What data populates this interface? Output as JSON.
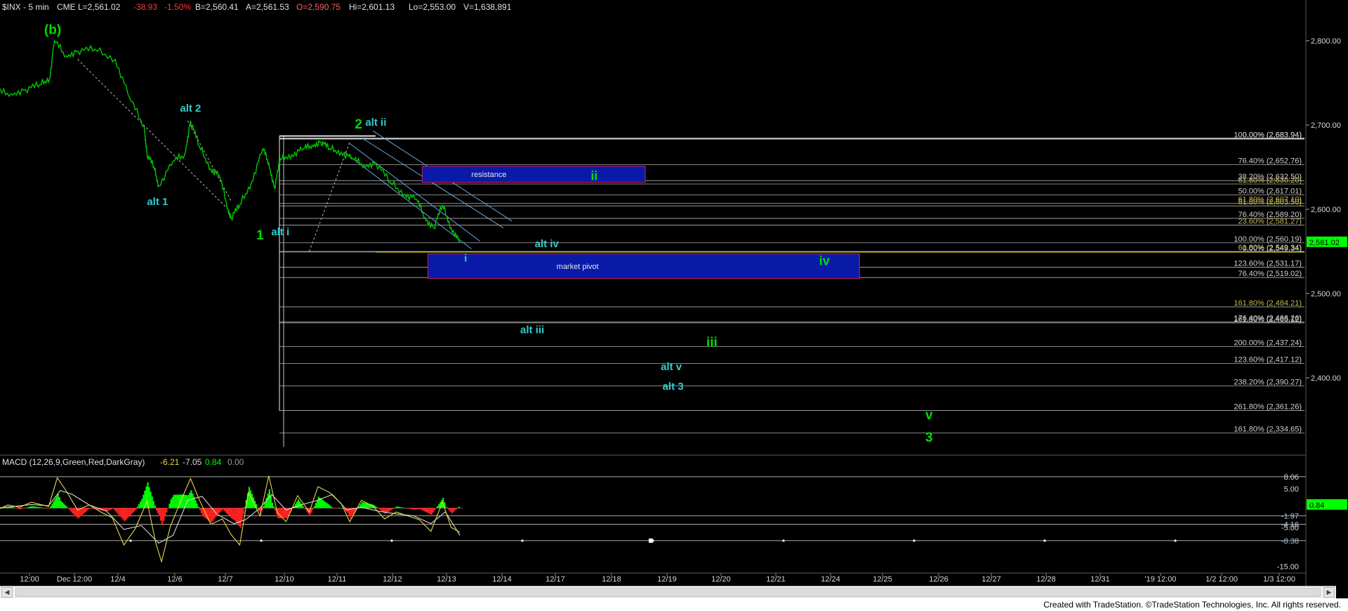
{
  "header": {
    "symbol": "$INX - 5 min",
    "exchange": "CME",
    "last": "L=2,561.02",
    "change": "-38.93",
    "pct": "-1.50%",
    "bid": "B=2,560.41",
    "ask": "A=2,561.53",
    "open": "O=2,590.75",
    "high": "Hi=2,601.13",
    "low": "Lo=2,553.00",
    "volume": "V=1,638,891"
  },
  "colors": {
    "price": "#00c800",
    "wave_green": "#00dd00",
    "wave_cyan": "#33cccc",
    "pos": "#00ff00",
    "neg": "#ff2222",
    "fib_line": "#b0b0b0",
    "box_fill": "#0a1aa8",
    "box_border": "#cc2266",
    "last_tag": "#00ff00"
  },
  "price_axis": {
    "labels": [
      "2,800.00",
      "2,700.00",
      "2,600.00",
      "2,500.00",
      "2,400.00"
    ],
    "last_price_tag": "2,561.02"
  },
  "time_axis": {
    "labels": [
      "12:00",
      "Dec 12:00",
      "12/4",
      "12/6",
      "12/7",
      "12/10",
      "12/11",
      "12/12",
      "12/13",
      "12/14",
      "12/17",
      "12/18",
      "12/19",
      "12/20",
      "12/21",
      "12/24",
      "12/25",
      "12/26",
      "12/27",
      "12/28",
      "12/31",
      "'19 12:00",
      "1/2 12:00",
      "1/3 12:00"
    ]
  },
  "chart_data": [
    {
      "type": "line",
      "title": "$INX - 5 min",
      "x_unit": "trading-session index (0 = 11/30, 1 = 12/3 … 11 = 12/17)",
      "ylim": [
        2315,
        2830
      ],
      "grid": false,
      "price_path": [
        [
          0.0,
          2740
        ],
        [
          0.25,
          2737
        ],
        [
          0.5,
          2742
        ],
        [
          0.75,
          2748
        ],
        [
          0.92,
          2756
        ],
        [
          1.0,
          2800
        ],
        [
          1.2,
          2782
        ],
        [
          1.4,
          2788
        ],
        [
          1.7,
          2790
        ],
        [
          2.05,
          2778
        ],
        [
          2.3,
          2732
        ],
        [
          2.55,
          2698
        ],
        [
          2.6,
          2665
        ],
        [
          2.72,
          2650
        ],
        [
          2.8,
          2628
        ],
        [
          3.05,
          2657
        ],
        [
          3.25,
          2665
        ],
        [
          3.35,
          2705
        ],
        [
          3.5,
          2675
        ],
        [
          3.7,
          2648
        ],
        [
          3.85,
          2640
        ],
        [
          4.0,
          2600
        ],
        [
          4.05,
          2590
        ],
        [
          4.2,
          2605
        ],
        [
          4.4,
          2632
        ],
        [
          4.6,
          2672
        ],
        [
          4.7,
          2655
        ],
        [
          4.8,
          2625
        ],
        [
          4.9,
          2660
        ],
        [
          5.1,
          2665
        ],
        [
          5.3,
          2672
        ],
        [
          5.45,
          2676
        ],
        [
          5.6,
          2680
        ],
        [
          5.75,
          2672
        ],
        [
          5.95,
          2668
        ],
        [
          6.15,
          2660
        ],
        [
          6.35,
          2652
        ],
        [
          6.55,
          2655
        ],
        [
          6.8,
          2632
        ],
        [
          7.05,
          2618
        ],
        [
          7.25,
          2612
        ],
        [
          7.4,
          2590
        ],
        [
          7.55,
          2578
        ],
        [
          7.7,
          2605
        ],
        [
          7.85,
          2578
        ],
        [
          8.0,
          2561
        ]
      ],
      "fib_levels": [
        {
          "pct": "100.00%",
          "value": "2,683.94",
          "y": 2683.9
        },
        {
          "pct": "0.00%",
          "value": "2,683.94",
          "y": 2683.9
        },
        {
          "pct": "76.40%",
          "value": "2,652.76",
          "y": 2652.8
        },
        {
          "pct": "38.20%",
          "value": "2,632.50",
          "y": 2634.0
        },
        {
          "pct": "61.80%",
          "value": "2,630.20",
          "y": 2630.0
        },
        {
          "pct": "50.00%",
          "value": "2,617.01",
          "y": 2617.0
        },
        {
          "pct": "61.80%",
          "value": "2,607.10",
          "y": 2607.1
        },
        {
          "pct": "61.80%",
          "value": "2,603.50",
          "y": 2604.0
        },
        {
          "pct": "76.40%",
          "value": "2,589.20",
          "y": 2589.2
        },
        {
          "pct": "23.60%",
          "value": "2,581.27",
          "y": 2581.3
        },
        {
          "pct": "100.00%",
          "value": "2,560.19",
          "y": 2560.2
        },
        {
          "pct": "61.80%",
          "value": "2,549.34",
          "y": 2550.0
        },
        {
          "pct": "0.00%",
          "value": "2,549.34",
          "y": 2549.3
        },
        {
          "pct": "123.60%",
          "value": "2,531.17",
          "y": 2531.2
        },
        {
          "pct": "76.40%",
          "value": "2,519.02",
          "y": 2519.0
        },
        {
          "pct": "161.80%",
          "value": "2,484.21",
          "y": 2484.2
        },
        {
          "pct": "176.40%",
          "value": "2,466.26",
          "y": 2466.3
        },
        {
          "pct": "161.80%",
          "value": "2,465.12",
          "y": 2465.1
        },
        {
          "pct": "200.00%",
          "value": "2,437.24",
          "y": 2437.2
        },
        {
          "pct": "123.60%",
          "value": "2,417.12",
          "y": 2417.1
        },
        {
          "pct": "238.20%",
          "value": "2,390.27",
          "y": 2390.3
        },
        {
          "pct": "261.80%",
          "value": "2,361.26",
          "y": 2361.3
        },
        {
          "pct": "161.80%",
          "value": "2,334.65",
          "y": 2334.7
        }
      ],
      "zones": [
        {
          "label": "resistance",
          "wave": "ii",
          "x0": 7.35,
          "x1": 11.2,
          "y0": 2632,
          "y1": 2651
        },
        {
          "label": "market pivot",
          "wave": "iv",
          "x0": 7.45,
          "x1": 14.9,
          "y0": 2518,
          "y1": 2547
        }
      ],
      "wave_labels": [
        {
          "text": "(b)",
          "x": 0.97,
          "y": 2808,
          "color": "green"
        },
        {
          "text": "alt 2",
          "x": 3.35,
          "y": 2716,
          "color": "cyan"
        },
        {
          "text": "alt 1",
          "x": 2.78,
          "y": 2605,
          "color": "cyan"
        },
        {
          "text": "2",
          "x": 6.25,
          "y": 2696,
          "color": "green"
        },
        {
          "text": "alt ii",
          "x": 6.55,
          "y": 2699,
          "color": "cyan"
        },
        {
          "text": "1",
          "x": 4.55,
          "y": 2564,
          "color": "green"
        },
        {
          "text": "alt i",
          "x": 4.9,
          "y": 2569,
          "color": "cyan"
        },
        {
          "text": "i",
          "x": 8.1,
          "y": 2538,
          "color": "cyan"
        },
        {
          "text": "alt iv",
          "x": 9.5,
          "y": 2555,
          "color": "cyan"
        },
        {
          "text": "alt iii",
          "x": 9.25,
          "y": 2453,
          "color": "cyan"
        },
        {
          "text": "iii",
          "x": 12.35,
          "y": 2437,
          "color": "green"
        },
        {
          "text": "alt v",
          "x": 11.65,
          "y": 2409,
          "color": "cyan"
        },
        {
          "text": "alt 3",
          "x": 11.68,
          "y": 2386,
          "color": "cyan"
        },
        {
          "text": "v",
          "x": 16.1,
          "y": 2351,
          "color": "green"
        },
        {
          "text": "3",
          "x": 16.1,
          "y": 2324,
          "color": "green"
        }
      ]
    },
    {
      "type": "area",
      "title": "MACD (12,26,9,Green,Red,DarkGray)",
      "values_text": [
        "-6.21",
        "-7.05",
        "0.84",
        "0.00"
      ],
      "ylim": [
        -16,
        12
      ],
      "axis_labels": [
        "8.06",
        "5.00",
        "-1.97",
        "-4.16",
        "-5.00",
        "-8.38",
        "-15.00"
      ],
      "last_tag": "0.84",
      "levels": [
        8.06,
        -1.97,
        -4.16,
        -8.38
      ],
      "macd_line": [
        [
          0.0,
          -0.5
        ],
        [
          0.2,
          0.8
        ],
        [
          0.4,
          0.2
        ],
        [
          0.6,
          1.5
        ],
        [
          0.9,
          0.4
        ],
        [
          1.05,
          7.8
        ],
        [
          1.2,
          4.5
        ],
        [
          1.4,
          -0.5
        ],
        [
          1.6,
          0.8
        ],
        [
          1.8,
          -1.0
        ],
        [
          2.0,
          -2.5
        ],
        [
          2.2,
          -9.5
        ],
        [
          2.4,
          -5.2
        ],
        [
          2.6,
          1.8
        ],
        [
          2.75,
          -9.0
        ],
        [
          2.85,
          -13.8
        ],
        [
          3.0,
          -4.8
        ],
        [
          3.2,
          2.5
        ],
        [
          3.35,
          7.6
        ],
        [
          3.5,
          2.2
        ],
        [
          3.7,
          -4.2
        ],
        [
          3.9,
          -2.8
        ],
        [
          4.05,
          -6.8
        ],
        [
          4.2,
          -9.5
        ],
        [
          4.35,
          4.0
        ],
        [
          4.55,
          -2.0
        ],
        [
          4.7,
          8.3
        ],
        [
          4.85,
          -1.2
        ],
        [
          5.0,
          -3.5
        ],
        [
          5.2,
          3.2
        ],
        [
          5.4,
          -1.0
        ],
        [
          5.55,
          5.5
        ],
        [
          5.75,
          4.0
        ],
        [
          5.95,
          1.2
        ],
        [
          6.1,
          -3.5
        ],
        [
          6.3,
          2.0
        ],
        [
          6.5,
          0.5
        ],
        [
          6.7,
          -2.8
        ],
        [
          6.9,
          -1.0
        ],
        [
          7.1,
          -2.0
        ],
        [
          7.3,
          -3.0
        ],
        [
          7.5,
          -6.0
        ],
        [
          7.7,
          1.5
        ],
        [
          7.85,
          -5.0
        ],
        [
          8.0,
          -6.2
        ]
      ],
      "signal_line": [
        [
          0.0,
          0.0
        ],
        [
          0.3,
          0.4
        ],
        [
          0.6,
          0.9
        ],
        [
          0.9,
          0.6
        ],
        [
          1.1,
          4.5
        ],
        [
          1.3,
          3.6
        ],
        [
          1.6,
          0.8
        ],
        [
          1.9,
          -0.8
        ],
        [
          2.2,
          -5.5
        ],
        [
          2.5,
          -4.5
        ],
        [
          2.8,
          -9.0
        ],
        [
          3.05,
          -7.0
        ],
        [
          3.3,
          2.0
        ],
        [
          3.55,
          3.0
        ],
        [
          3.8,
          -1.5
        ],
        [
          4.1,
          -4.0
        ],
        [
          4.3,
          -3.0
        ],
        [
          4.55,
          0.0
        ],
        [
          4.75,
          3.5
        ],
        [
          5.0,
          -0.5
        ],
        [
          5.25,
          0.8
        ],
        [
          5.5,
          1.8
        ],
        [
          5.8,
          3.5
        ],
        [
          6.05,
          -0.5
        ],
        [
          6.3,
          0.2
        ],
        [
          6.6,
          -0.8
        ],
        [
          6.9,
          -1.5
        ],
        [
          7.2,
          -2.0
        ],
        [
          7.5,
          -4.0
        ],
        [
          7.75,
          -1.0
        ],
        [
          8.0,
          -7.0
        ]
      ]
    }
  ],
  "footer": {
    "credit": "Created with TradeStation. ©TradeStation Technologies, Inc. All rights reserved."
  }
}
